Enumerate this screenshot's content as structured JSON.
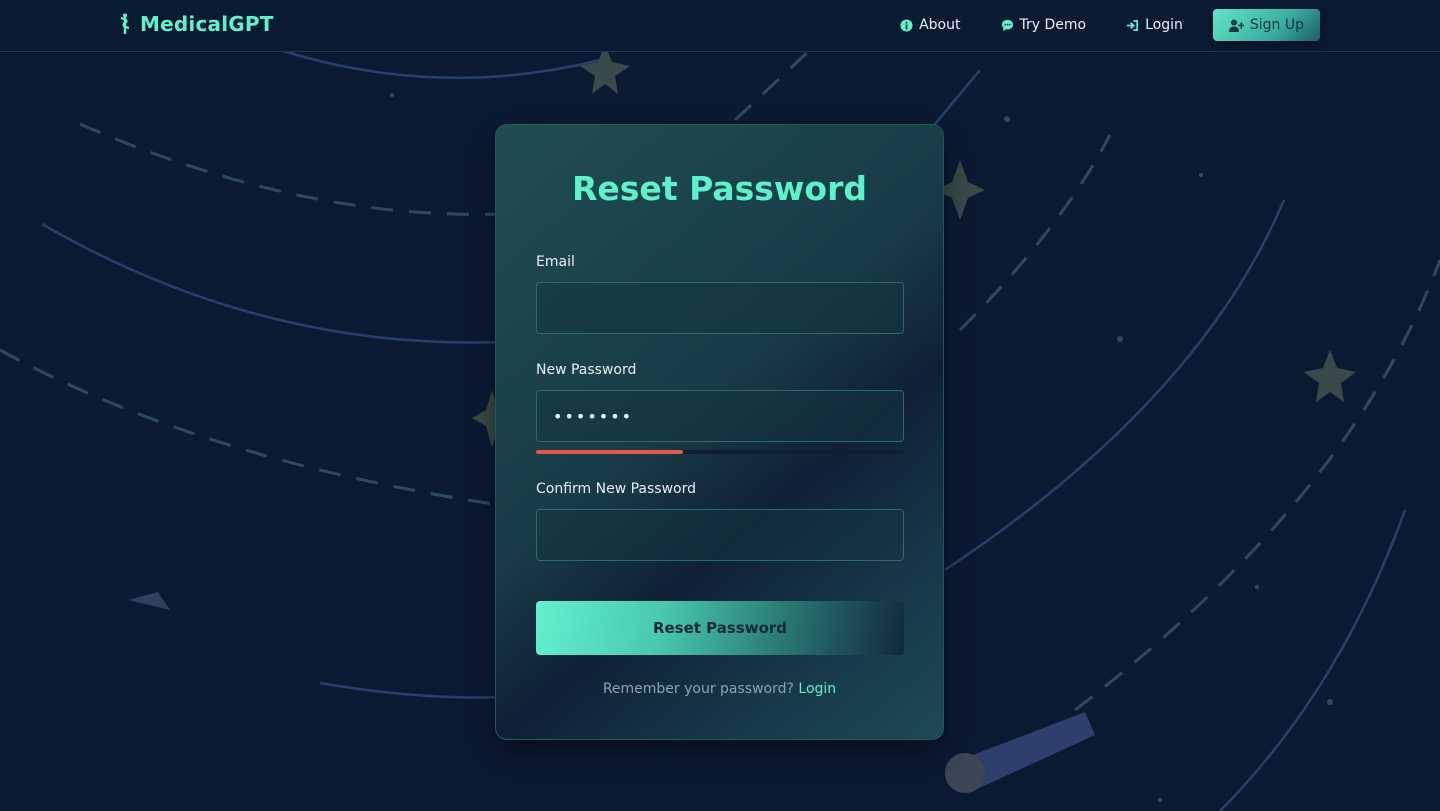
{
  "nav": {
    "brand": "MedicalGPT",
    "links": [
      {
        "label": "About",
        "icon": "info-icon"
      },
      {
        "label": "Try Demo",
        "icon": "chat-icon"
      },
      {
        "label": "Login",
        "icon": "login-icon"
      }
    ],
    "signup_label": "Sign Up"
  },
  "form": {
    "title": "Reset Password",
    "email_label": "Email",
    "email_value": "",
    "new_password_label": "New Password",
    "new_password_value": "•••••••",
    "strength_fraction": 0.4,
    "strength_color": "#e0594a",
    "confirm_label": "Confirm New Password",
    "confirm_value": "",
    "submit_label": "Reset Password",
    "remember_text": "Remember your password?",
    "login_link": "Login"
  },
  "colors": {
    "accent": "#5ef2cc",
    "background": "#0b1a33"
  }
}
